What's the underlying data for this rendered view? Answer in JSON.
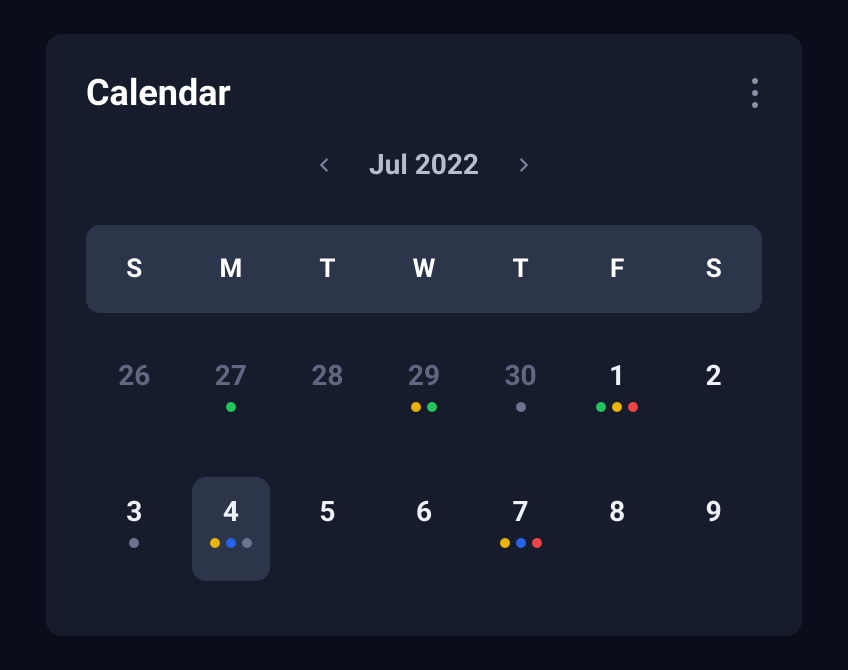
{
  "title": "Calendar",
  "monthLabel": "Jul 2022",
  "dayHeaders": [
    "S",
    "M",
    "T",
    "W",
    "T",
    "F",
    "S"
  ],
  "weeks": [
    [
      {
        "num": "26",
        "muted": true,
        "dots": []
      },
      {
        "num": "27",
        "muted": true,
        "dots": [
          "green"
        ]
      },
      {
        "num": "28",
        "muted": true,
        "dots": []
      },
      {
        "num": "29",
        "muted": true,
        "dots": [
          "yellow",
          "green"
        ]
      },
      {
        "num": "30",
        "muted": true,
        "dots": [
          "gray"
        ]
      },
      {
        "num": "1",
        "muted": false,
        "dots": [
          "green",
          "yellow",
          "red"
        ]
      },
      {
        "num": "2",
        "muted": false,
        "dots": []
      }
    ],
    [
      {
        "num": "3",
        "muted": false,
        "dots": [
          "gray"
        ]
      },
      {
        "num": "4",
        "muted": false,
        "dots": [
          "yellow",
          "blue",
          "gray"
        ],
        "selected": true
      },
      {
        "num": "5",
        "muted": false,
        "dots": []
      },
      {
        "num": "6",
        "muted": false,
        "dots": []
      },
      {
        "num": "7",
        "muted": false,
        "dots": [
          "yellow",
          "blue",
          "red"
        ]
      },
      {
        "num": "8",
        "muted": false,
        "dots": []
      },
      {
        "num": "9",
        "muted": false,
        "dots": []
      }
    ]
  ]
}
